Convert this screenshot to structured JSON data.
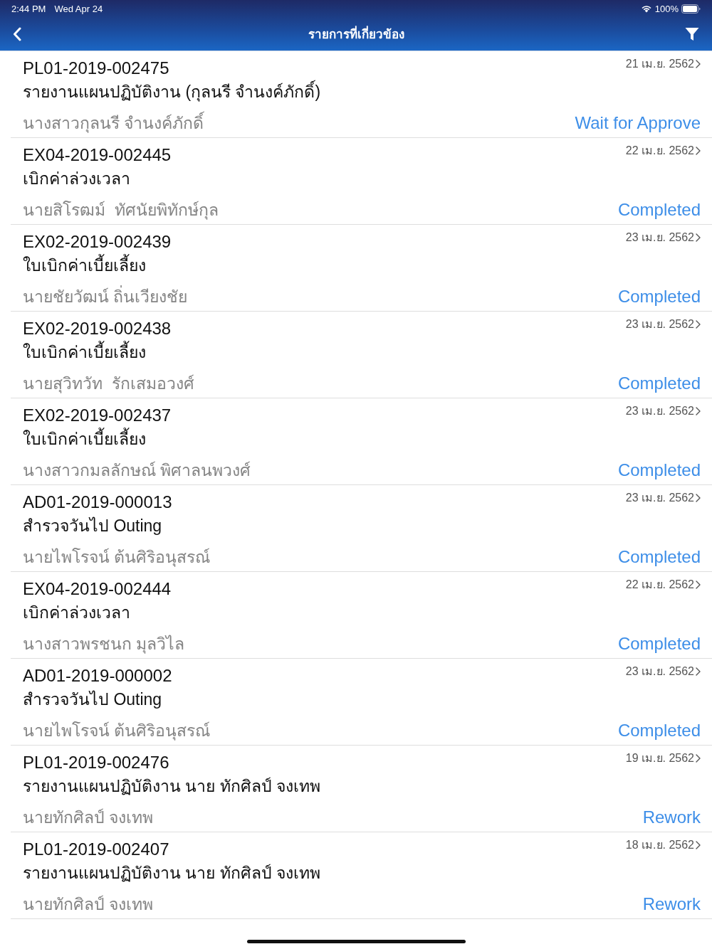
{
  "status_bar": {
    "time": "2:44 PM",
    "date": "Wed Apr 24",
    "battery": "100%"
  },
  "nav_bar": {
    "title": "รายการที่เกี่ยวข้อง"
  },
  "items": [
    {
      "code": "PL01-2019-002475",
      "title": "รายงานแผนปฏิบัติงาน (กุลนรี จำนงค์ภักดิ์)",
      "person": "นางสาวกุลนรี จำนงค์ภักดิ์",
      "date": "21 เม.ย. 2562",
      "status": "Wait for Approve"
    },
    {
      "code": "EX04-2019-002445",
      "title": "เบิกค่าล่วงเวลา",
      "person": "นายสิโรฒม์  ทัศนัยพิทักษ์กุล",
      "date": "22 เม.ย. 2562",
      "status": "Completed"
    },
    {
      "code": "EX02-2019-002439",
      "title": "ใบเบิกค่าเบี้ยเลี้ยง",
      "person": "นายชัยวัฒน์ ถิ่นเวียงชัย",
      "date": "23 เม.ย. 2562",
      "status": "Completed"
    },
    {
      "code": "EX02-2019-002438",
      "title": "ใบเบิกค่าเบี้ยเลี้ยง",
      "person": "นายสุวิทวัท  รักเสมอวงศ์",
      "date": "23 เม.ย. 2562",
      "status": "Completed"
    },
    {
      "code": "EX02-2019-002437",
      "title": "ใบเบิกค่าเบี้ยเลี้ยง",
      "person": "นางสาวกมลลักษณ์ พิศาลนพวงศ์",
      "date": "23 เม.ย. 2562",
      "status": "Completed"
    },
    {
      "code": "AD01-2019-000013",
      "title": "สำรวจวันไป Outing",
      "person": "นายไพโรจน์ ต้นศิริอนุสรณ์",
      "date": "23 เม.ย. 2562",
      "status": "Completed"
    },
    {
      "code": "EX04-2019-002444",
      "title": "เบิกค่าล่วงเวลา",
      "person": "นางสาวพรชนก มุลวิไล",
      "date": "22 เม.ย. 2562",
      "status": "Completed"
    },
    {
      "code": "AD01-2019-000002",
      "title": "สำรวจวันไป Outing",
      "person": "นายไพโรจน์ ต้นศิริอนุสรณ์",
      "date": "23 เม.ย. 2562",
      "status": "Completed"
    },
    {
      "code": "PL01-2019-002476",
      "title": "รายงานแผนปฏิบัติงาน นาย ทักศิลป์ จงเทพ",
      "person": "นายทักศิลป์ จงเทพ",
      "date": "19 เม.ย. 2562",
      "status": "Rework"
    },
    {
      "code": "PL01-2019-002407",
      "title": "รายงานแผนปฏิบัติงาน นาย ทักศิลป์ จงเทพ",
      "person": "นายทักศิลป์ จงเทพ",
      "date": "18 เม.ย. 2562",
      "status": "Rework"
    }
  ]
}
